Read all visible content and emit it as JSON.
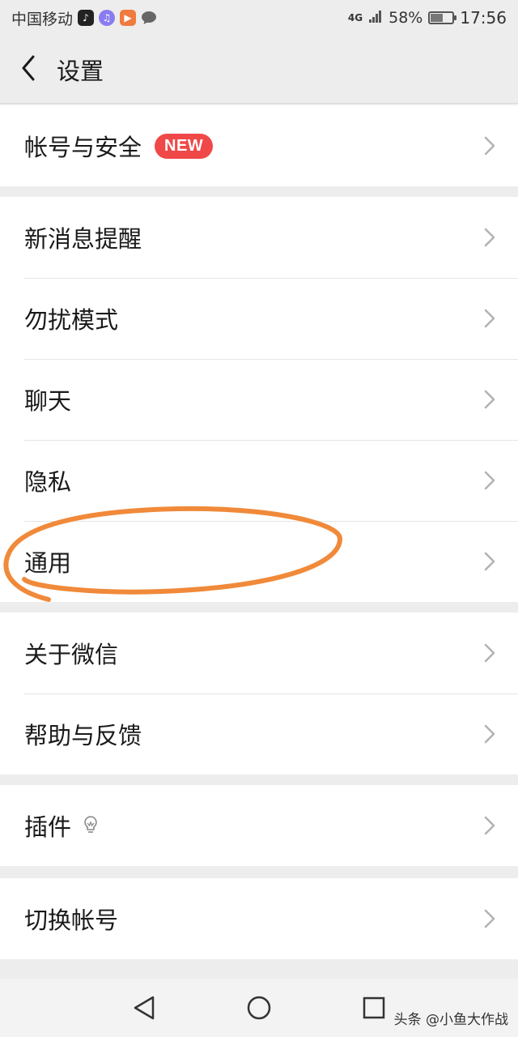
{
  "status_bar": {
    "carrier": "中国移动",
    "network": "4G",
    "battery_percent": "58%",
    "battery_level": 0.58,
    "time": "17:56"
  },
  "header": {
    "title": "设置"
  },
  "groups": [
    {
      "items": [
        {
          "label": "帐号与安全",
          "badge": "NEW"
        }
      ]
    },
    {
      "items": [
        {
          "label": "新消息提醒"
        },
        {
          "label": "勿扰模式"
        },
        {
          "label": "聊天"
        },
        {
          "label": "隐私"
        },
        {
          "label": "通用"
        }
      ]
    },
    {
      "items": [
        {
          "label": "关于微信"
        },
        {
          "label": "帮助与反馈"
        }
      ]
    },
    {
      "items": [
        {
          "label": "插件",
          "icon": "lightbulb-icon"
        }
      ]
    },
    {
      "items": [
        {
          "label": "切换帐号"
        }
      ]
    }
  ],
  "annotation": {
    "color": "#f08a3a",
    "target": "通用"
  },
  "watermark": "头条 @小鱼大作战",
  "colors": {
    "badge": "#f04848",
    "background": "#ededed",
    "annotation": "#f08a3a"
  }
}
